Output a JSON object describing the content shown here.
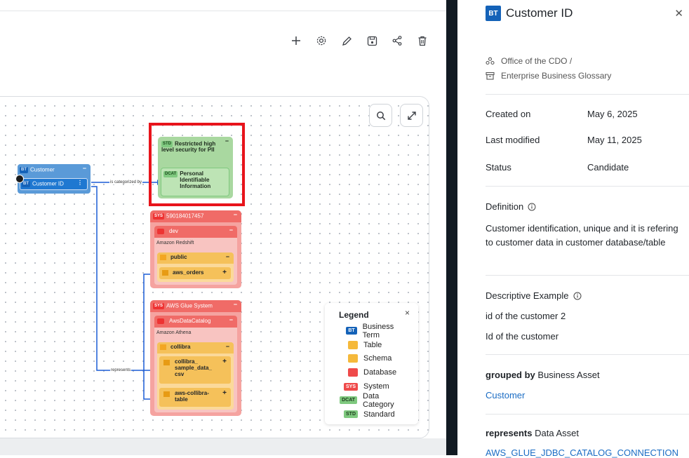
{
  "graph": {
    "customer_node": {
      "tag": "BT",
      "title": "Customer",
      "child_tag": "BT",
      "child_label": "Customer ID"
    },
    "edge_categorized": "is categorized by",
    "edge_represents": "represents",
    "std_node": {
      "tag": "STD",
      "label": "Restricted high level security for PII"
    },
    "dcat_node": {
      "tag": "DCAT",
      "label": "Personal Identifiable Information"
    },
    "sys1": {
      "tag": "SYS",
      "title": "590184017457",
      "db_label": "dev",
      "db_sub": "Amazon Redshift",
      "schema": "public",
      "table": "aws_orders"
    },
    "sys2": {
      "tag": "SYS",
      "title": "AWS Glue System",
      "db_label": "AwsDataCatalog",
      "db_sub": "Amazon Athena",
      "schema": "collibra",
      "table1": "collibra_ sample_data_ csv",
      "table2": "aws-collibra- table"
    }
  },
  "legend": {
    "title": "Legend",
    "items": [
      {
        "icon": "BT",
        "label": "Business Term",
        "color": "#1462b8"
      },
      {
        "icon": "table-icon",
        "label": "Table",
        "color": "#f5b93b"
      },
      {
        "icon": "schema-icon",
        "label": "Schema",
        "color": "#f5b93b"
      },
      {
        "icon": "database-icon",
        "label": "Database",
        "color": "#ef4a4a"
      },
      {
        "icon": "SYS",
        "label": "System",
        "color": "#ef4a4a"
      },
      {
        "icon": "DCAT",
        "label": "Data Category",
        "color": "#7fc97f"
      },
      {
        "icon": "STD",
        "label": "Standard",
        "color": "#7fc97f"
      }
    ]
  },
  "panel": {
    "badge": "BT",
    "title": "Customer ID",
    "breadcrumb": [
      "Office of the CDO  /",
      "Enterprise Business Glossary"
    ],
    "meta": [
      {
        "key": "Created on",
        "value": "May 6, 2025"
      },
      {
        "key": "Last modified",
        "value": "May 11, 2025"
      },
      {
        "key": "Status",
        "value": "Candidate"
      }
    ],
    "definition_title": "Definition",
    "definition_text": "Customer identification, unique and it is refering to customer data in customer database/table",
    "example_title": "Descriptive Example",
    "examples": [
      "id of the customer 2",
      "Id of the customer"
    ],
    "grouped_by_bold": "grouped by",
    "grouped_by_rest": " Business Asset",
    "grouped_link": "Customer",
    "represents_bold": "represents",
    "represents_rest": " Data Asset",
    "represents_link": "AWS_GLUE_JDBC_CATALOG_CONNECTION"
  }
}
